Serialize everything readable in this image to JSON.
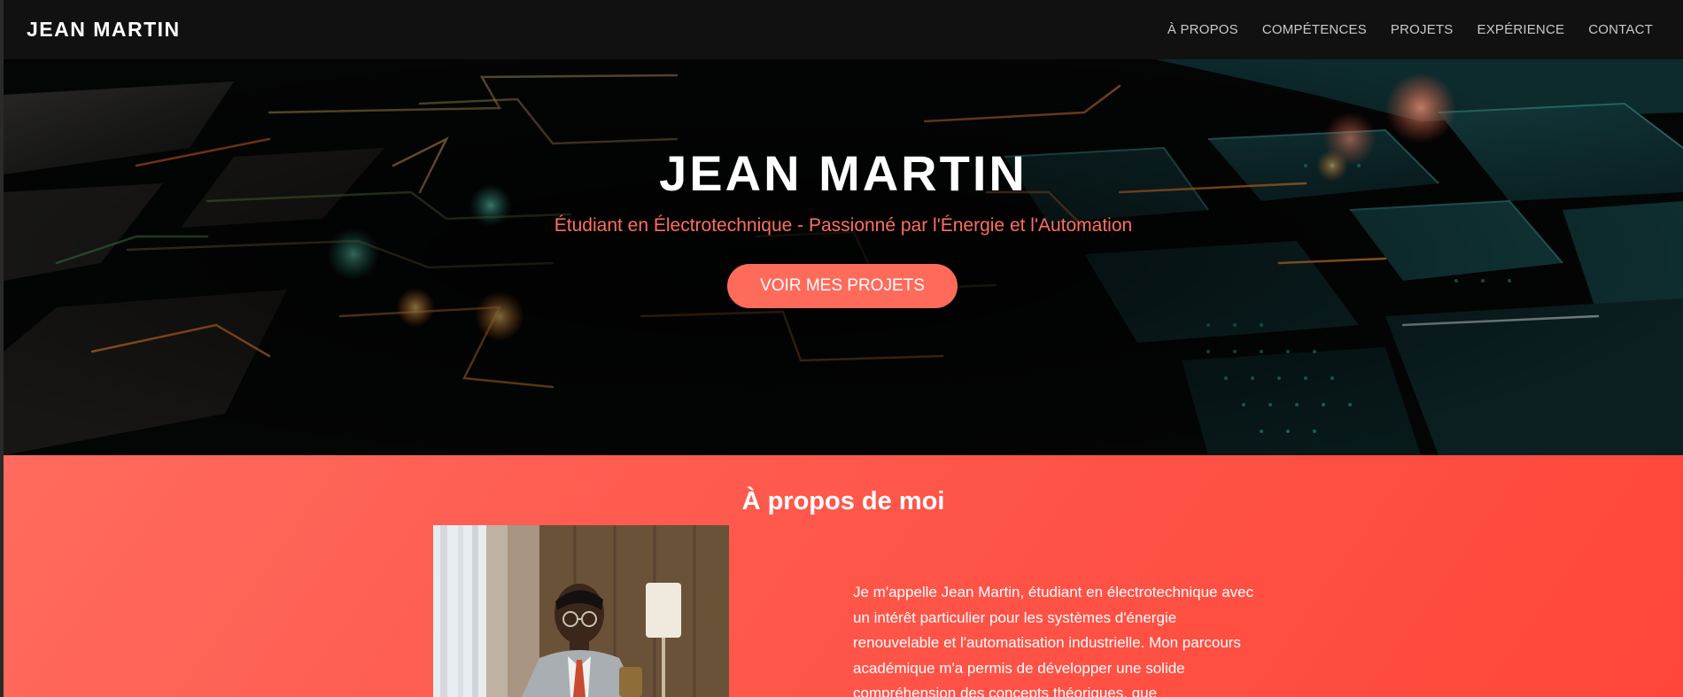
{
  "header": {
    "logo": "JEAN MARTIN",
    "nav": [
      "À PROPOS",
      "COMPÉTENCES",
      "PROJETS",
      "EXPÉRIENCE",
      "CONTACT"
    ]
  },
  "hero": {
    "title": "JEAN MARTIN",
    "subtitle": "Étudiant en Électrotechnique - Passionné par l'Énergie et l'Automation",
    "cta": "VOIR MES PROJETS"
  },
  "about": {
    "title": "À propos de moi",
    "text": "Je m'appelle Jean Martin, étudiant en électrotechnique avec un intérêt particulier pour les systèmes d'énergie renouvelable et l'automatisation industrielle. Mon parcours académique m'a permis de développer une solide compréhension des concepts théoriques, que"
  },
  "colors": {
    "accent": "#ff6b5b",
    "navbar": "#111111",
    "about_gradient_start": "#ff6b5e",
    "about_gradient_end": "#ff463a"
  },
  "icons": [
    "hero-circuit-image",
    "portrait-photo"
  ]
}
